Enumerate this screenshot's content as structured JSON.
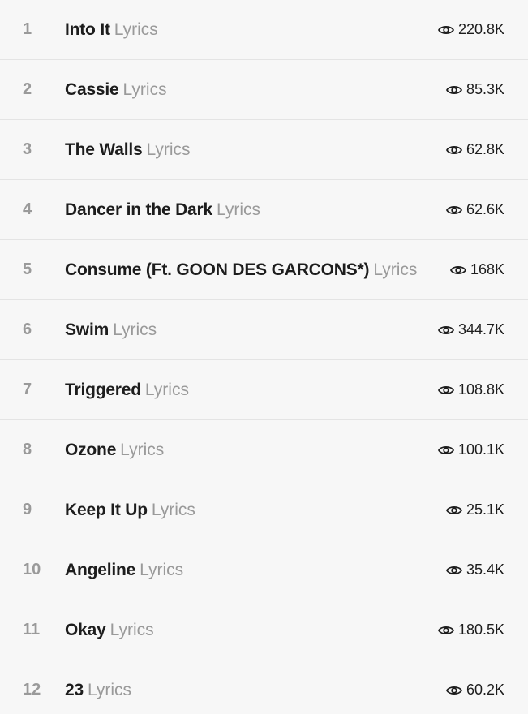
{
  "tracks": [
    {
      "number": "1",
      "title": "Into It",
      "suffix": "Lyrics",
      "views": "220.8K"
    },
    {
      "number": "2",
      "title": "Cassie",
      "suffix": "Lyrics",
      "views": "85.3K"
    },
    {
      "number": "3",
      "title": "The Walls",
      "suffix": "Lyrics",
      "views": "62.8K"
    },
    {
      "number": "4",
      "title": "Dancer in the Dark",
      "suffix": "Lyrics",
      "views": "62.6K"
    },
    {
      "number": "5",
      "title": "Consume (Ft. GOON DES GARCONS*)",
      "suffix": "Lyrics",
      "views": "168K"
    },
    {
      "number": "6",
      "title": "Swim",
      "suffix": "Lyrics",
      "views": "344.7K"
    },
    {
      "number": "7",
      "title": "Triggered",
      "suffix": "Lyrics",
      "views": "108.8K"
    },
    {
      "number": "8",
      "title": "Ozone",
      "suffix": "Lyrics",
      "views": "100.1K"
    },
    {
      "number": "9",
      "title": "Keep It Up",
      "suffix": "Lyrics",
      "views": "25.1K"
    },
    {
      "number": "10",
      "title": "Angeline",
      "suffix": "Lyrics",
      "views": "35.4K"
    },
    {
      "number": "11",
      "title": "Okay",
      "suffix": "Lyrics",
      "views": "180.5K"
    },
    {
      "number": "12",
      "title": "23",
      "suffix": "Lyrics",
      "views": "60.2K"
    }
  ],
  "icons": {
    "views": "eye-icon"
  },
  "colors": {
    "background": "#f7f7f7",
    "title": "#1d1d1d",
    "muted": "#9a9a9a",
    "divider": "#e4e4e4"
  }
}
